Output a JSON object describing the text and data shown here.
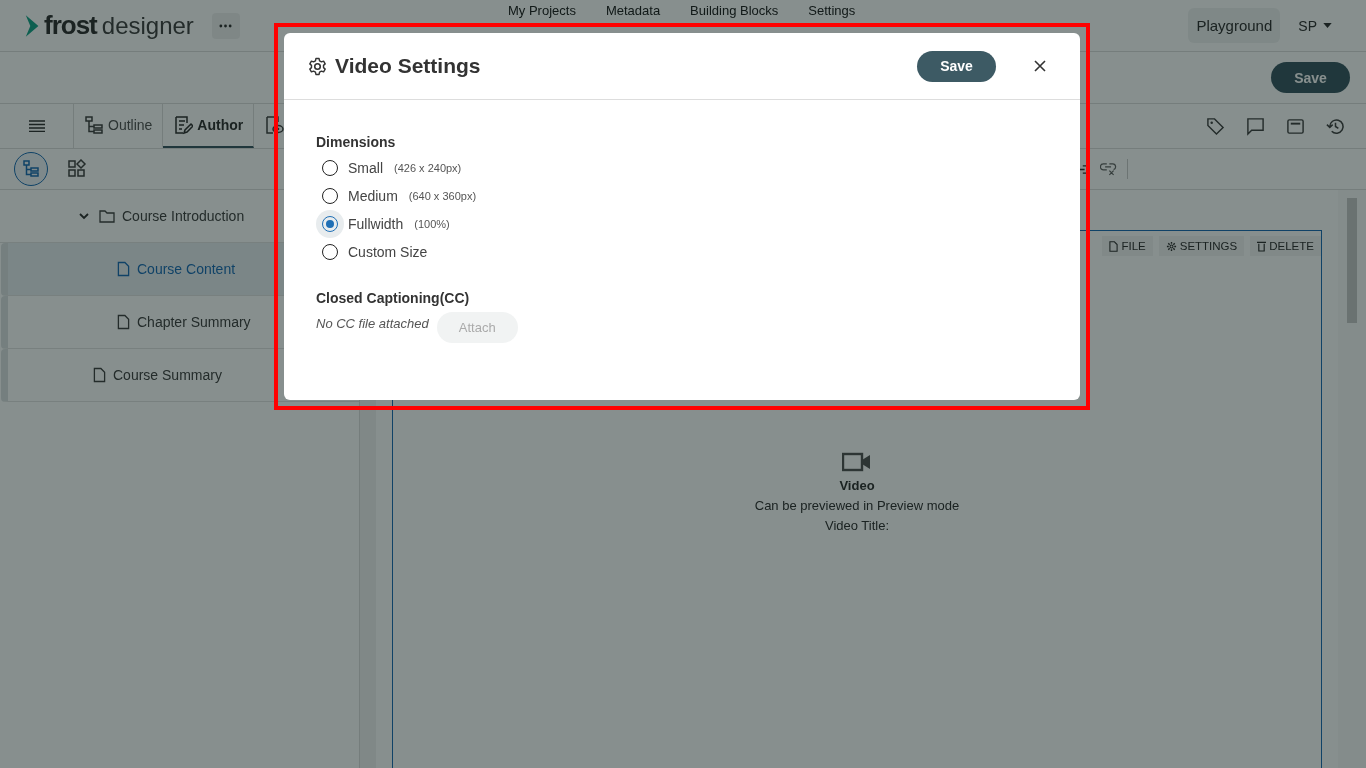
{
  "header": {
    "brand": "frost",
    "product": "designer",
    "nav": [
      {
        "label": "My Projects"
      },
      {
        "label": "Metadata"
      },
      {
        "label": "Building Blocks"
      },
      {
        "label": "Settings"
      }
    ],
    "workspace": "Playground",
    "user": "SP"
  },
  "action_bar": {
    "save": "Save"
  },
  "toolbar": {
    "tabs": [
      {
        "label": "Outline",
        "kind": "outline",
        "selected": false
      },
      {
        "label": "Author",
        "kind": "author",
        "selected": true
      },
      {
        "kind": "preview",
        "selected": false
      }
    ]
  },
  "sidebar": {
    "views": [
      {
        "kind": "tree",
        "selected": true
      },
      {
        "kind": "widgets",
        "selected": false
      }
    ],
    "tree": [
      {
        "label": "Course Introduction",
        "kind": "folder",
        "expanded": true,
        "selected": false,
        "children": [
          {
            "label": "Course Content",
            "kind": "page",
            "selected": true
          },
          {
            "label": "Chapter Summary",
            "kind": "page",
            "selected": false
          }
        ]
      },
      {
        "label": "Course Summary",
        "kind": "page",
        "selected": false
      }
    ]
  },
  "block": {
    "actions": [
      {
        "label": "FILE",
        "kind": "file"
      },
      {
        "label": "SETTINGS",
        "kind": "settings"
      },
      {
        "label": "DELETE",
        "kind": "delete"
      }
    ],
    "title": "Video",
    "hint": "Can be previewed in Preview mode",
    "video_title": "Video Title:"
  },
  "modal": {
    "title": "Video Settings",
    "save": "Save",
    "dimensions": {
      "label": "Dimensions",
      "options": [
        {
          "label": "Small",
          "detail": "(426 x 240px)",
          "selected": false
        },
        {
          "label": "Medium",
          "detail": "(640 x 360px)",
          "selected": false
        },
        {
          "label": "Fullwidth",
          "detail": "(100%)",
          "selected": true
        },
        {
          "label": "Custom Size",
          "selected": false
        }
      ]
    },
    "captions": {
      "label": "Closed Captioning(CC)",
      "status": "No CC file attached",
      "attach": "Attach",
      "attach_disabled": true
    }
  }
}
